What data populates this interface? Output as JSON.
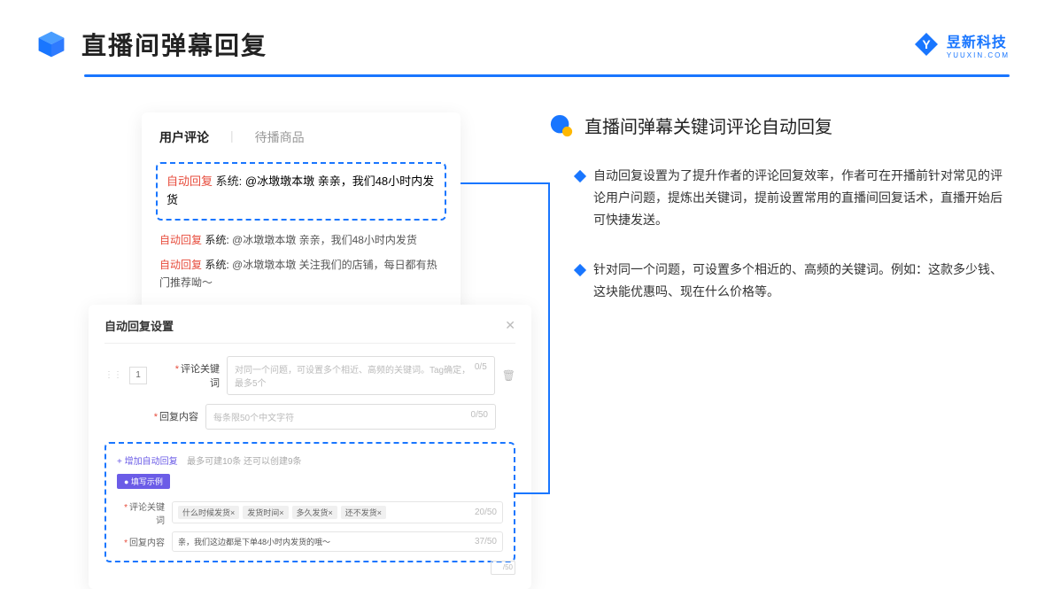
{
  "header": {
    "title": "直播间弹幕回复",
    "logo_text": "昱新科技",
    "logo_sub": "YUUXIN.COM"
  },
  "card1": {
    "tab_active": "用户评论",
    "tab_inactive": "待播商品",
    "highlight_auto": "自动回复",
    "highlight_sys": "系统:",
    "highlight_text": "@冰墩墩本墩 亲亲，我们48小时内发货",
    "row2_auto": "自动回复",
    "row2_sys": "系统:",
    "row2_text": "@冰墩墩本墩 亲亲，我们48小时内发货",
    "row3_auto": "自动回复",
    "row3_sys": "系统:",
    "row3_text": "@冰墩墩本墩 关注我们的店铺，每日都有热门推荐呦～"
  },
  "card2": {
    "title": "自动回复设置",
    "row_num": "1",
    "label_keyword": "评论关键词",
    "placeholder_keyword": "对同一个问题，可设置多个相近、高频的关键词。Tag确定，最多5个",
    "count_keyword": "0/5",
    "label_content": "回复内容",
    "placeholder_content": "每条限50个中文字符",
    "count_content": "0/50",
    "add_link": "+ 增加自动回复",
    "add_hint": "最多可建10条 还可以创建9条",
    "badge": "● 填写示例",
    "sample_kw_label": "评论关键词",
    "sample_tags": [
      "什么时候发货×",
      "发货时间×",
      "多久发货×",
      "还不发货×"
    ],
    "sample_kw_count": "20/50",
    "sample_ct_label": "回复内容",
    "sample_ct_text": "亲，我们这边都是下单48小时内发货的哦～",
    "sample_ct_count": "37/50",
    "tiny_count": "/50"
  },
  "right": {
    "section_title": "直播间弹幕关键词评论自动回复",
    "bullet1": "自动回复设置为了提升作者的评论回复效率，作者可在开播前针对常见的评论用户问题，提炼出关键词，提前设置常用的直播间回复话术，直播开始后可快捷发送。",
    "bullet2": "针对同一个问题，可设置多个相近的、高频的关键词。例如：这款多少钱、这块能优惠吗、现在什么价格等。"
  }
}
